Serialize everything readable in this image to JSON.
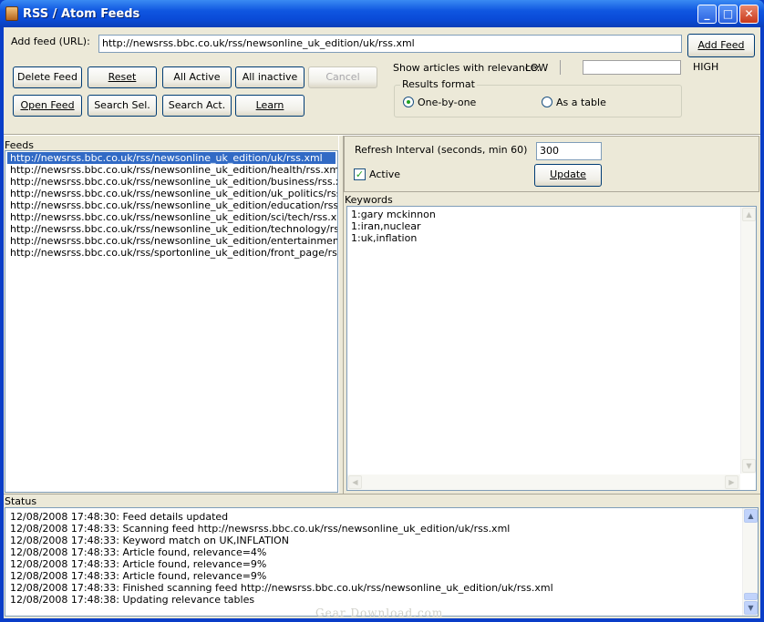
{
  "window": {
    "title": "RSS / Atom Feeds",
    "controls": {
      "minimize": "_",
      "maximize": "□",
      "close": "✕"
    }
  },
  "top": {
    "add_feed_label": "Add feed (URL):",
    "add_feed_value": "http://newsrss.bbc.co.uk/rss/newsonline_uk_edition/uk/rss.xml",
    "add_feed_button": "Add Feed",
    "buttons": {
      "delete_feed": "Delete Feed",
      "reset": "Reset",
      "all_active": "All Active",
      "all_inactive": "All inactive",
      "cancel": "Cancel",
      "open_feed": "Open Feed",
      "search_sel": "Search Sel.",
      "search_act": "Search Act.",
      "learn": "Learn"
    },
    "relevance_label": "Show articles with relevance:",
    "relevance_low": "LOW",
    "relevance_high": "HIGH",
    "relevance_level": 0.0,
    "results_format": {
      "title": "Results format",
      "options": [
        "One-by-one",
        "As a table"
      ],
      "selected": "One-by-one"
    }
  },
  "feeds": {
    "label": "Feeds",
    "items": [
      "http://newsrss.bbc.co.uk/rss/newsonline_uk_edition/uk/rss.xml",
      "http://newsrss.bbc.co.uk/rss/newsonline_uk_edition/health/rss.xml",
      "http://newsrss.bbc.co.uk/rss/newsonline_uk_edition/business/rss.xml",
      "http://newsrss.bbc.co.uk/rss/newsonline_uk_edition/uk_politics/rss.xml",
      "http://newsrss.bbc.co.uk/rss/newsonline_uk_edition/education/rss.xml",
      "http://newsrss.bbc.co.uk/rss/newsonline_uk_edition/sci/tech/rss.xml",
      "http://newsrss.bbc.co.uk/rss/newsonline_uk_edition/technology/rss.xml",
      "http://newsrss.bbc.co.uk/rss/newsonline_uk_edition/entertainment/rss.xm",
      "http://newsrss.bbc.co.uk/rss/sportonline_uk_edition/front_page/rss.xml"
    ],
    "selected_index": 0
  },
  "details": {
    "refresh_label": "Refresh Interval (seconds, min 60)",
    "refresh_value": "300",
    "active_label": "Active",
    "active_checked": true,
    "update_button": "Update",
    "keywords_label": "Keywords",
    "keywords": [
      "1:gary mckinnon",
      "1:iran,nuclear",
      "1:uk,inflation"
    ]
  },
  "status": {
    "label": "Status",
    "lines": [
      "12/08/2008 17:48:30: Feed details updated",
      "12/08/2008 17:48:33: Scanning feed http://newsrss.bbc.co.uk/rss/newsonline_uk_edition/uk/rss.xml",
      "12/08/2008 17:48:33: Keyword match on UK,INFLATION",
      "12/08/2008 17:48:33: Article found, relevance=4%",
      "12/08/2008 17:48:33: Article found, relevance=9%",
      "12/08/2008 17:48:33: Article found, relevance=9%",
      "12/08/2008 17:48:33: Finished scanning feed http://newsrss.bbc.co.uk/rss/newsonline_uk_edition/uk/rss.xml",
      "12/08/2008 17:48:38: Updating relevance tables"
    ]
  },
  "watermark": "Gear Download.com"
}
